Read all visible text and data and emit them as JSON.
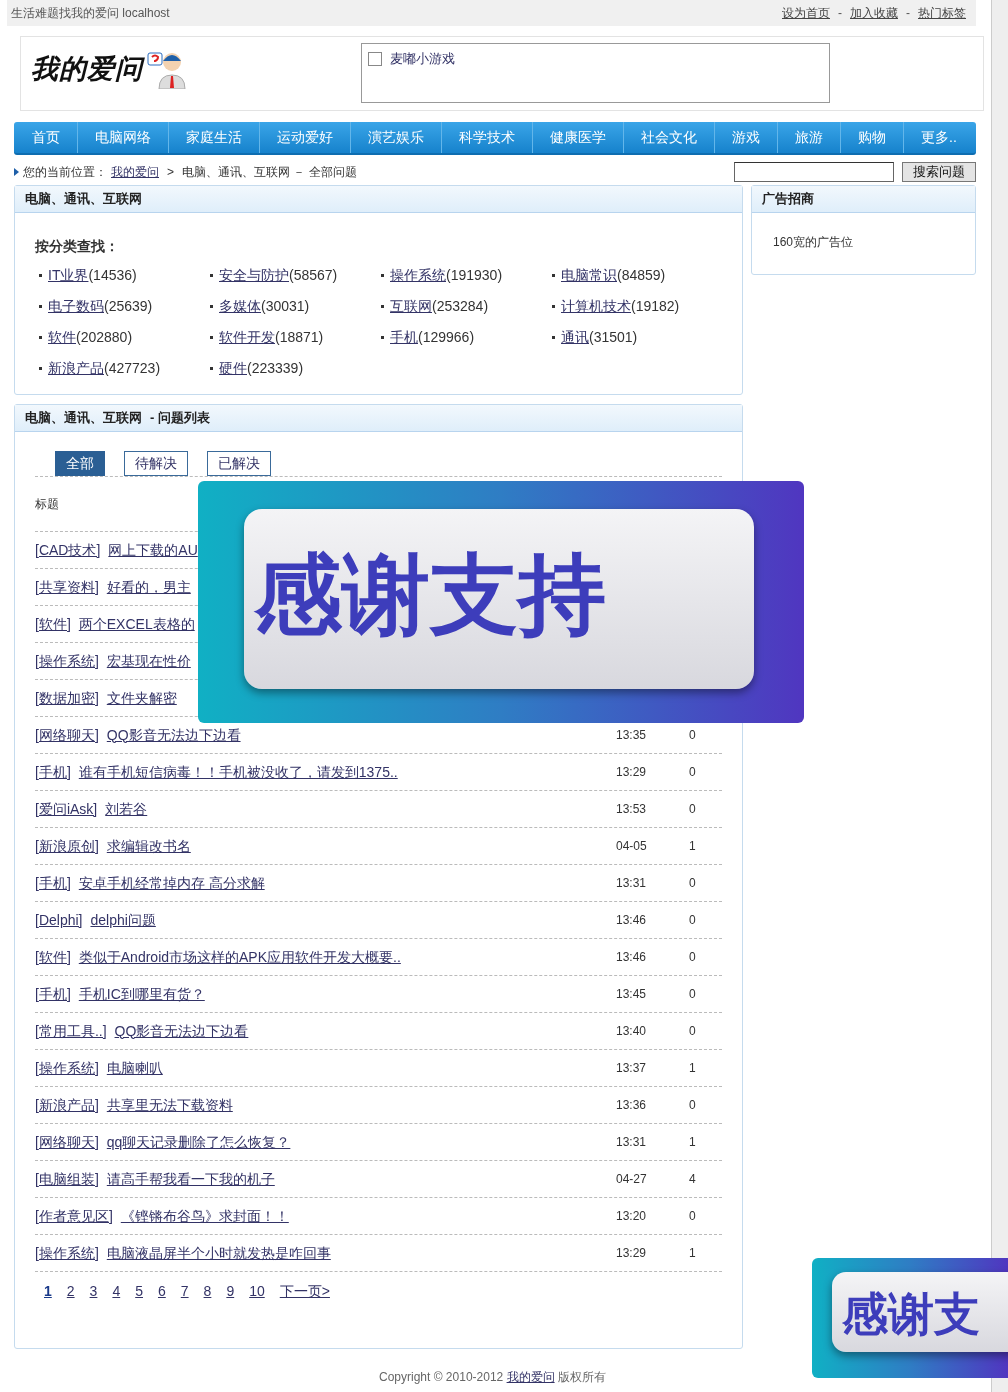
{
  "top_bar": {
    "tagline": "生活难题找我的爱问  localhost",
    "separator": "-",
    "links": [
      "设为首页",
      "加入收藏",
      "热门标签"
    ]
  },
  "header": {
    "logo_text": "我的爱问",
    "ad": {
      "kind": "broken-image",
      "text": "麦嘟小游戏"
    }
  },
  "nav": [
    "首页",
    "电脑网络",
    "家庭生活",
    "运动爱好",
    "演艺娱乐",
    "科学技术",
    "健康医学",
    "社会文化",
    "游戏",
    "旅游",
    "购物",
    "更多.."
  ],
  "breadcrumb": {
    "prefix": "您的当前位置：",
    "separator": ">",
    "items": [
      {
        "kind": "link",
        "label": "我的爱问"
      },
      {
        "kind": "text",
        "label": "电脑、通讯、互联网 － 全部问题"
      }
    ]
  },
  "search": {
    "button": "搜索问题"
  },
  "category_panel": {
    "title": "电脑、通讯、互联网",
    "heading": "按分类查找：",
    "items": [
      {
        "name": "IT业界",
        "count": "(14536)"
      },
      {
        "name": "安全与防护",
        "count": "(58567)"
      },
      {
        "name": "操作系统",
        "count": "(191930)"
      },
      {
        "name": "电脑常识",
        "count": "(84859)"
      },
      {
        "name": "电子数码",
        "count": "(25639)"
      },
      {
        "name": "多媒体",
        "count": "(30031)"
      },
      {
        "name": "互联网",
        "count": "(253284)"
      },
      {
        "name": "计算机技术",
        "count": "(19182)"
      },
      {
        "name": "软件",
        "count": "(202880)"
      },
      {
        "name": "软件开发",
        "count": "(18871)"
      },
      {
        "name": "手机",
        "count": "(129966)"
      },
      {
        "name": "通讯",
        "count": "(31501)"
      },
      {
        "name": "新浪产品",
        "count": "(427723)"
      },
      {
        "name": "硬件",
        "count": "(223339)"
      }
    ]
  },
  "ad_panel": {
    "title": "广告招商",
    "text": "160宽的广告位"
  },
  "question_panel": {
    "title": "电脑、通讯、互联网",
    "subtitle": "- 问题列表",
    "tabs": [
      {
        "label": "全部",
        "selected": true
      },
      {
        "label": "待解决",
        "selected": false
      },
      {
        "label": "已解决",
        "selected": false
      }
    ],
    "columns": [
      "标题"
    ],
    "rows": [
      {
        "category": "[CAD技术]",
        "title": "网上下载的AU"
      },
      {
        "category": "[共享资料]",
        "title": "好看的，男主"
      },
      {
        "category": "[软件]",
        "title": "两个EXCEL表格的"
      },
      {
        "category": "[操作系统]",
        "title": "宏基现在性价"
      },
      {
        "category": "[数据加密]",
        "title": "文件夹解密"
      },
      {
        "category": "[网络聊天]",
        "title": "QQ影音无法边下边看",
        "time": "13:35",
        "answers": "0"
      },
      {
        "category": "[手机]",
        "title": "谁有手机短信病毒！！手机被没收了，请发到1375..",
        "time": "13:29",
        "answers": "0"
      },
      {
        "category": "[爱问iAsk]",
        "title": "刘若谷",
        "time": "13:53",
        "answers": "0"
      },
      {
        "category": "[新浪原创]",
        "title": "求编辑改书名",
        "time": "04-05",
        "answers": "1"
      },
      {
        "category": "[手机]",
        "title": "安卓手机经常掉内存 高分求解",
        "time": "13:31",
        "answers": "0"
      },
      {
        "category": "[Delphi]",
        "title": "delphi问题",
        "time": "13:46",
        "answers": "0"
      },
      {
        "category": "[软件]",
        "title": "类似于Android市场这样的APK应用软件开发大概要..",
        "time": "13:46",
        "answers": "0"
      },
      {
        "category": "[手机]",
        "title": "手机IC到哪里有货？",
        "time": "13:45",
        "answers": "0"
      },
      {
        "category": "[常用工具..]",
        "title": "QQ影音无法边下边看",
        "time": "13:40",
        "answers": "0"
      },
      {
        "category": "[操作系统]",
        "title": "电脑喇叭",
        "time": "13:37",
        "answers": "1"
      },
      {
        "category": "[新浪产品]",
        "title": "共享里无法下载资料",
        "time": "13:36",
        "answers": "0"
      },
      {
        "category": "[网络聊天]",
        "title": "qq聊天记录删除了怎么恢复？",
        "time": "13:31",
        "answers": "1"
      },
      {
        "category": "[电脑组装]",
        "title": "请高手帮我看一下我的机子",
        "time": "04-27",
        "answers": "4"
      },
      {
        "category": "[作者意见区]",
        "title": "《铿锵布谷鸟》求封面！！",
        "time": "13:20",
        "answers": "0"
      },
      {
        "category": "[操作系统]",
        "title": "电脑液晶屏半个小时就发热是咋回事",
        "time": "13:29",
        "answers": "1"
      }
    ],
    "pagination": {
      "pages": [
        {
          "label": "1",
          "selected": true
        },
        {
          "label": "2",
          "selected": false
        },
        {
          "label": "3",
          "selected": false
        },
        {
          "label": "4",
          "selected": false
        },
        {
          "label": "5",
          "selected": false
        },
        {
          "label": "6",
          "selected": false
        },
        {
          "label": "7",
          "selected": false
        },
        {
          "label": "8",
          "selected": false
        },
        {
          "label": "9",
          "selected": false
        },
        {
          "label": "10",
          "selected": false
        }
      ],
      "next": "下一页>"
    }
  },
  "footer": {
    "copyright": "Copyright © 2010-2012",
    "link": "我的爱问",
    "suffix": "版权所有"
  },
  "overlays": [
    {
      "kind": "large",
      "text": "感谢支持"
    },
    {
      "kind": "corner",
      "text": "感谢支"
    }
  ]
}
